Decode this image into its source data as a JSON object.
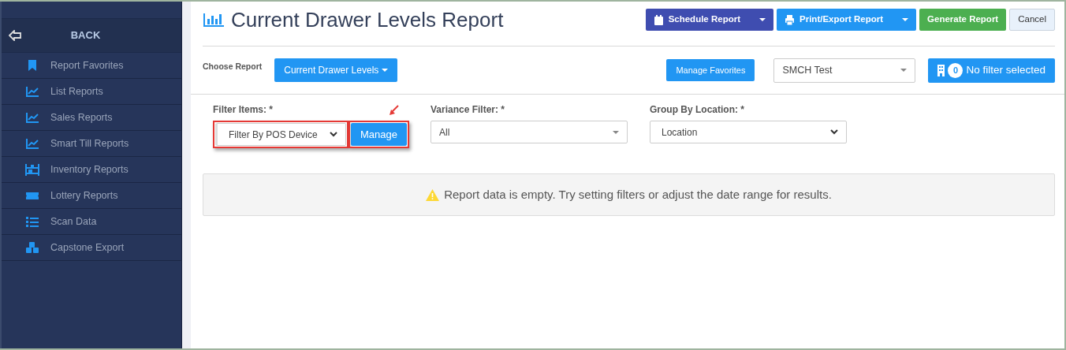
{
  "sidebar": {
    "back": {
      "label": "BACK"
    },
    "items": [
      {
        "label": "Report Favorites"
      },
      {
        "label": "List Reports"
      },
      {
        "label": "Sales Reports"
      },
      {
        "label": "Smart Till Reports"
      },
      {
        "label": "Inventory Reports"
      },
      {
        "label": "Lottery Reports"
      },
      {
        "label": "Scan Data"
      },
      {
        "label": "Capstone Export"
      }
    ]
  },
  "header": {
    "title": "Current Drawer Levels Report",
    "buttons": [
      {
        "label": "Schedule Report",
        "dropdown": true
      },
      {
        "label": "Print/Export Report",
        "dropdown": true
      },
      {
        "label": "Generate Report",
        "dropdown": false
      },
      {
        "label": "Cancel",
        "dropdown": false
      }
    ]
  },
  "toolbar": {
    "choose_label": "Choose Report",
    "report_button": "Current Drawer Levels",
    "favorites_button": "Manage Favorites",
    "store_select": "SMCH Test",
    "filter_count": "0",
    "filter_label": "No filter selected"
  },
  "filters": [
    {
      "label": "Filter Items: *",
      "value": "Filter By POS Device",
      "kind": "select-button",
      "button": "Manage",
      "highlighted": true
    },
    {
      "label": "Variance Filter: *",
      "value": "All",
      "kind": "select2",
      "highlighted": false
    },
    {
      "label": "Group By Location: *",
      "value": "Location",
      "kind": "select",
      "highlighted": false
    }
  ],
  "alert": {
    "text": "Report data is empty. Try setting filters or adjust the date range for results."
  }
}
